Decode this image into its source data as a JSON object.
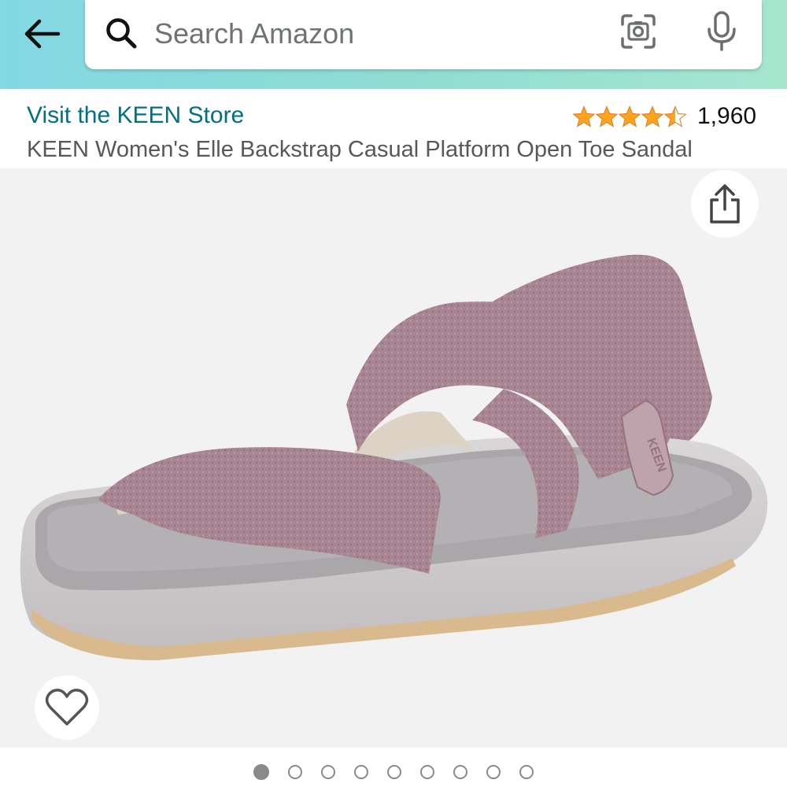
{
  "search": {
    "placeholder": "Search Amazon",
    "value": ""
  },
  "icons": {
    "back": "arrow-left-icon",
    "search": "search-icon",
    "camera": "camera-scan-icon",
    "mic": "microphone-icon",
    "share": "share-icon",
    "wishlist": "heart-outline-icon",
    "star": "star-icon"
  },
  "product": {
    "store_link": "Visit the KEEN Store",
    "rating_value": 4.5,
    "rating_count": "1,960",
    "title": "KEEN Women's Elle Backstrap Casual Platform Open Toe Sandal"
  },
  "carousel": {
    "total_images": 9,
    "active_index": 0
  },
  "colors": {
    "header_gradient_start": "#82d8e3",
    "header_gradient_end": "#a6e6cf",
    "link": "#007185",
    "star": "#ffa41c",
    "title_text": "#565959",
    "image_background": "#f2f2f2",
    "strap": "#a88592",
    "footbed": "#a7a5a9",
    "sole": "#cfccce"
  }
}
